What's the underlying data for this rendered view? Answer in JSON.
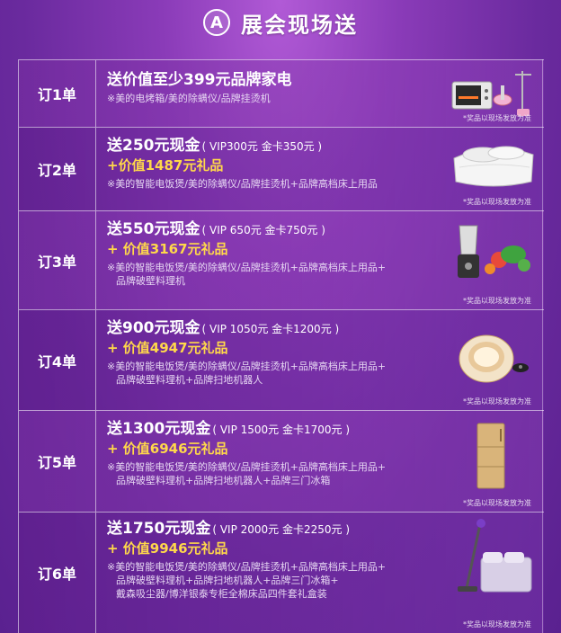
{
  "header": {
    "badge": "A",
    "title": "展会现场送"
  },
  "rows": [
    {
      "label": "订1单",
      "main": "送价值至少399元品牌家电",
      "vip": "",
      "gift": "",
      "desc": [
        "※美的电烤箱/美的除螨仪/品牌挂烫机"
      ],
      "note": "*奖品以现场发放为准",
      "image": "oven-mite-steamer"
    },
    {
      "label": "订2单",
      "main": "送250元现金",
      "vip": "( VIP300元 金卡350元 )",
      "gift": "+价值1487元礼品",
      "desc": [
        "※美的智能电饭煲/美的除螨仪/品牌挂烫机+品牌高档床上用品"
      ],
      "note": "*奖品以现场发放为准",
      "image": "bedding"
    },
    {
      "label": "订3单",
      "main": "送550元现金",
      "vip": "( VIP 650元  金卡750元 )",
      "gift": "+ 价值3167元礼品",
      "desc": [
        "※美的智能电饭煲/美的除螨仪/品牌挂烫机+品牌高档床上用品+",
        "品牌破壁料理机"
      ],
      "note": "*奖品以现场发放为准",
      "image": "blender"
    },
    {
      "label": "订4单",
      "main": "送900元现金",
      "vip": "( VIP 1050元  金卡1200元 )",
      "gift": "+ 价值4947元礼品",
      "desc": [
        "※美的智能电饭煲/美的除螨仪/品牌挂烫机+品牌高档床上用品+",
        "品牌破壁料理机+品牌扫地机器人"
      ],
      "note": "*奖品以现场发放为准",
      "image": "robot-vacuum"
    },
    {
      "label": "订5单",
      "main": "送1300元现金",
      "vip": "( VIP 1500元  金卡1700元 )",
      "gift": "+ 价值6946元礼品",
      "desc": [
        "※美的智能电饭煲/美的除螨仪/品牌挂烫机+品牌高档床上用品+",
        "品牌破壁料理机+品牌扫地机器人+品牌三门冰箱"
      ],
      "note": "*奖品以现场发放为准",
      "image": "fridge"
    },
    {
      "label": "订6单",
      "main": "送1750元现金",
      "vip": "( VIP 2000元  金卡2250元 )",
      "gift": "+ 价值9946元礼品",
      "desc": [
        "※美的智能电饭煲/美的除螨仪/品牌挂烫机+品牌高档床上用品+",
        "品牌破壁料理机+品牌扫地机器人+品牌三门冰箱+",
        "戴森吸尘器/博洋银泰专柜全棉床品四件套礼盒装"
      ],
      "note": "*奖品以现场发放为准",
      "image": "stick-vacuum-bed"
    }
  ]
}
